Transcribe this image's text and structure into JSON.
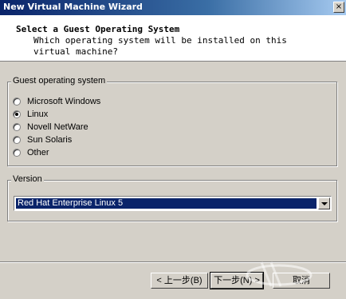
{
  "window": {
    "title": "New Virtual Machine Wizard",
    "close_glyph": "×"
  },
  "header": {
    "title": "Select a Guest Operating System",
    "subtitle": "Which operating system will be installed on this virtual machine?"
  },
  "guest_os": {
    "label": "Guest operating system",
    "options": [
      {
        "label": "Microsoft Windows",
        "selected": false
      },
      {
        "label": "Linux",
        "selected": true
      },
      {
        "label": "Novell NetWare",
        "selected": false
      },
      {
        "label": "Sun Solaris",
        "selected": false
      },
      {
        "label": "Other",
        "selected": false
      }
    ]
  },
  "version": {
    "label": "Version",
    "selected": "Red Hat Enterprise Linux 5"
  },
  "buttons": {
    "back": "< 上一步(B)",
    "next": "下一步(N) >",
    "cancel": "取消"
  },
  "colors": {
    "titlebar_start": "#0a246a",
    "selection_bg": "#0a246a",
    "window_bg": "#d4d0c8"
  }
}
